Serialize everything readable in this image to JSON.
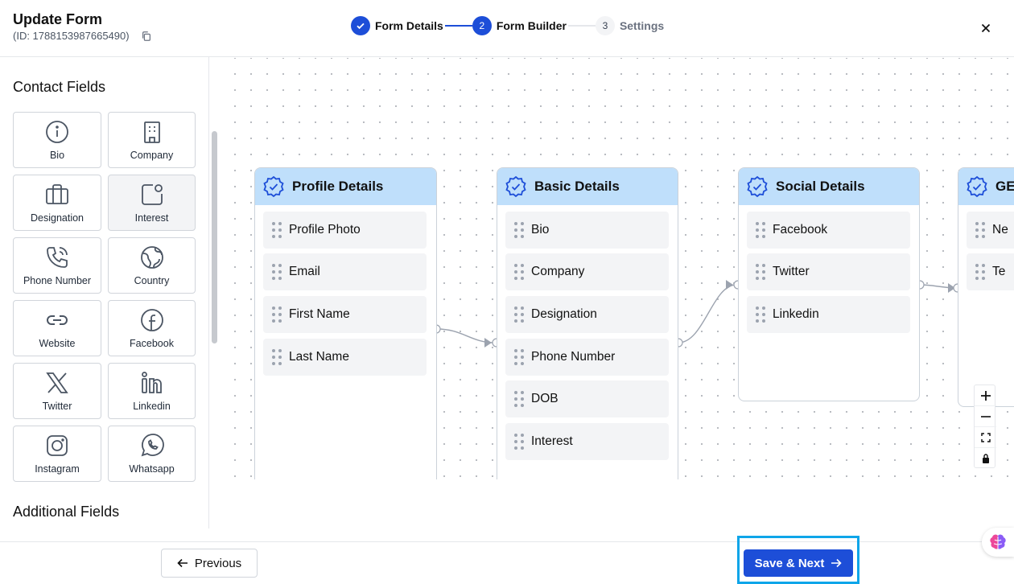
{
  "header": {
    "title": "Update Form",
    "form_id": "(ID: 1788153987665490)",
    "steps": [
      {
        "num": "1",
        "label": "Form Details",
        "state": "done"
      },
      {
        "num": "2",
        "label": "Form Builder",
        "state": "active"
      },
      {
        "num": "3",
        "label": "Settings",
        "state": "todo"
      }
    ]
  },
  "sidebar": {
    "contact_title": "Contact Fields",
    "additional_title": "Additional Fields",
    "tiles": [
      {
        "label": "Bio",
        "icon": "info-icon"
      },
      {
        "label": "Company",
        "icon": "building-icon"
      },
      {
        "label": "Designation",
        "icon": "briefcase-icon"
      },
      {
        "label": "Interest",
        "icon": "interest-icon"
      },
      {
        "label": "Phone Number",
        "icon": "phone-icon"
      },
      {
        "label": "Country",
        "icon": "globe-icon"
      },
      {
        "label": "Website",
        "icon": "link-icon"
      },
      {
        "label": "Facebook",
        "icon": "facebook-icon"
      },
      {
        "label": "Twitter",
        "icon": "x-twitter-icon"
      },
      {
        "label": "Linkedin",
        "icon": "linkedin-icon"
      },
      {
        "label": "Instagram",
        "icon": "instagram-icon"
      },
      {
        "label": "Whatsapp",
        "icon": "whatsapp-icon"
      }
    ]
  },
  "canvas": {
    "nodes": [
      {
        "title": "Profile Details",
        "fields": [
          "Profile Photo",
          "Email",
          "First Name",
          "Last Name"
        ]
      },
      {
        "title": "Basic Details",
        "fields": [
          "Bio",
          "Company",
          "Designation",
          "Phone Number",
          "DOB",
          "Interest"
        ]
      },
      {
        "title": "Social Details",
        "fields": [
          "Facebook",
          "Twitter",
          "Linkedin"
        ]
      },
      {
        "title": "GE",
        "fields": [
          "Ne",
          "Te"
        ]
      }
    ]
  },
  "footer": {
    "previous_label": "Previous",
    "save_label": "Save & Next"
  },
  "colors": {
    "primary": "#1d4ed8",
    "node_header": "#bfdffb",
    "highlight": "#0ea5e9"
  }
}
